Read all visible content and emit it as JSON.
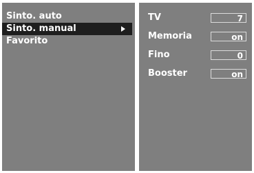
{
  "menu": {
    "items": [
      {
        "label": "Sinto. auto"
      },
      {
        "label": "Sinto. manual"
      },
      {
        "label": "Favorito"
      }
    ],
    "selected_index": 1,
    "submenu_icon": "arrow-right-icon"
  },
  "settings": {
    "rows": [
      {
        "label": "TV",
        "value": "7"
      },
      {
        "label": "Memoria",
        "value": "on"
      },
      {
        "label": "Fino",
        "value": "0"
      },
      {
        "label": "Booster",
        "value": "on"
      }
    ]
  },
  "colors": {
    "panel": "#7f7f7f",
    "selected": "#1e1e1e",
    "text": "#ffffff"
  }
}
